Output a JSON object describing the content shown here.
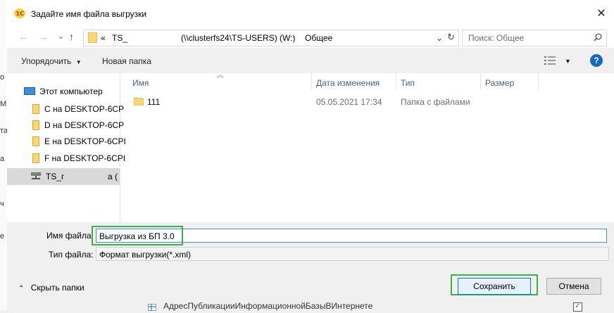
{
  "window": {
    "title": "Задайте имя файла выгрузки",
    "close_glyph": "✕"
  },
  "nav": {
    "back": "←",
    "forward": "→",
    "down": "⌄",
    "up": "↑"
  },
  "address": {
    "crumbs": [
      "«",
      "TS_",
      "(\\\\clusterfs24\\TS-USERS) (W:)",
      "Общее"
    ],
    "separator": "›",
    "refresh": "↻"
  },
  "search": {
    "placeholder": "Поиск: Общее"
  },
  "toolbar": {
    "organize": "Упорядочить",
    "organize_arrow": "▼",
    "new_folder": "Новая папка",
    "view_arrow": "▼",
    "help": "?"
  },
  "navpane": {
    "items": [
      {
        "label": "Этот компьютер",
        "icon": "computer-icon"
      },
      {
        "label": "C на DESKTOP-6CP",
        "icon": "drive-folder-icon"
      },
      {
        "label": "D на DESKTOP-6CP",
        "icon": "drive-folder-icon"
      },
      {
        "label": "E на DESKTOP-6CPI",
        "icon": "drive-folder-icon"
      },
      {
        "label": "F на DESKTOP-6CPI",
        "icon": "drive-folder-icon"
      },
      {
        "label": "TS_r",
        "suffix": "а (",
        "icon": "network-drive-icon"
      }
    ]
  },
  "columns": [
    "Имя",
    "Дата изменения",
    "Тип",
    "Размер"
  ],
  "files": [
    {
      "name": "111",
      "modified": "05.05.2021 17:34",
      "type": "Папка с файлами",
      "size": ""
    }
  ],
  "form": {
    "filename_label": "Имя файла:",
    "filename_value": "Выгрузка из БП 3.0",
    "filetype_label": "Тип файла:",
    "filetype_value": "Формат выгрузки(*.xml)",
    "filetype_arrow": "⌄"
  },
  "footer": {
    "hide_folders": "Скрыть папки",
    "hide_arrow": "⌃",
    "save": "Сохранить",
    "cancel": "Отмена"
  },
  "background": {
    "left_chars": [
      "о",
      "М",
      "та",
      "а",
      "ч",
      "е"
    ],
    "bottom_text": "АдресПубликацииИнформационнойБазыВИнтернете",
    "checkbox_mark": "✓"
  },
  "colors": {
    "highlight": "#3cb043",
    "accent": "#0078d7"
  }
}
